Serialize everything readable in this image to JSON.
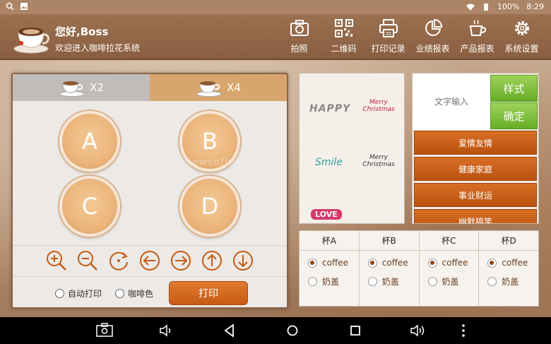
{
  "status": {
    "battery": "100%",
    "time": "8:29"
  },
  "header": {
    "greeting": "您好,Boss",
    "subtitle": "欢迎进入咖啡拉花系统",
    "tools": [
      {
        "label": "拍照",
        "icon": "camera-icon"
      },
      {
        "label": "二维码",
        "icon": "qrcode-icon"
      },
      {
        "label": "打印记录",
        "icon": "printer-icon"
      },
      {
        "label": "业绩报表",
        "icon": "pie-chart-icon"
      },
      {
        "label": "产品报表",
        "icon": "cup-icon"
      },
      {
        "label": "系统设置",
        "icon": "gear-icon"
      }
    ]
  },
  "tabs": [
    {
      "label": "X2",
      "active": false
    },
    {
      "label": "X4",
      "active": true
    }
  ],
  "cups": [
    "A",
    "B",
    "C",
    "D"
  ],
  "controls": [
    "zoom-in-icon",
    "zoom-out-icon",
    "rotate-icon",
    "arrow-left-icon",
    "arrow-right-icon",
    "arrow-up-icon",
    "arrow-down-icon"
  ],
  "print": {
    "auto_print": "自动打印",
    "coffee_color": "咖啡色",
    "print_button": "打印"
  },
  "patterns": [
    "HAPPY",
    "Merry Christmas",
    "Smile",
    "Merry Christmas",
    "LOVE"
  ],
  "watermark": "newcoffee",
  "text_panel": {
    "input_placeholder": "文字输入",
    "style_button": "样式",
    "confirm_button": "确定",
    "categories": [
      "爱情友情",
      "健康家庭",
      "事业财运",
      "幽默搞笑"
    ]
  },
  "cup_table": {
    "columns": [
      "杯A",
      "杯B",
      "杯C",
      "杯D"
    ],
    "option_coffee": "coffee",
    "option_lid": "奶盖",
    "selected": "coffee"
  },
  "colors": {
    "accent_orange": "#c75b14",
    "green": "#66ad27",
    "brown": "#8a5f41"
  }
}
